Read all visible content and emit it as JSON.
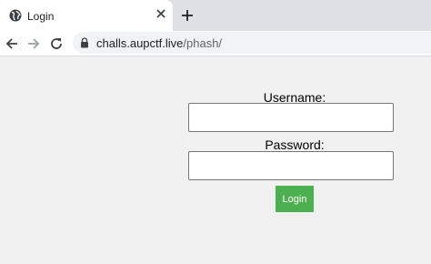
{
  "browser": {
    "tab": {
      "title": "Login",
      "favicon": "globe-icon",
      "close_icon": "close-icon"
    },
    "new_tab_icon": "plus-icon",
    "toolbar": {
      "back_icon": "back-arrow-icon",
      "forward_icon": "forward-arrow-icon",
      "reload_icon": "reload-icon",
      "lock_icon": "lock-icon",
      "url_host": "challs.aupctf.live",
      "url_path": "/phash/"
    }
  },
  "form": {
    "username_label": "Username:",
    "username_value": "",
    "password_label": "Password:",
    "password_value": "",
    "login_button": "Login"
  },
  "colors": {
    "button_bg": "#4caf50",
    "page_bg": "#f1f1f1"
  }
}
